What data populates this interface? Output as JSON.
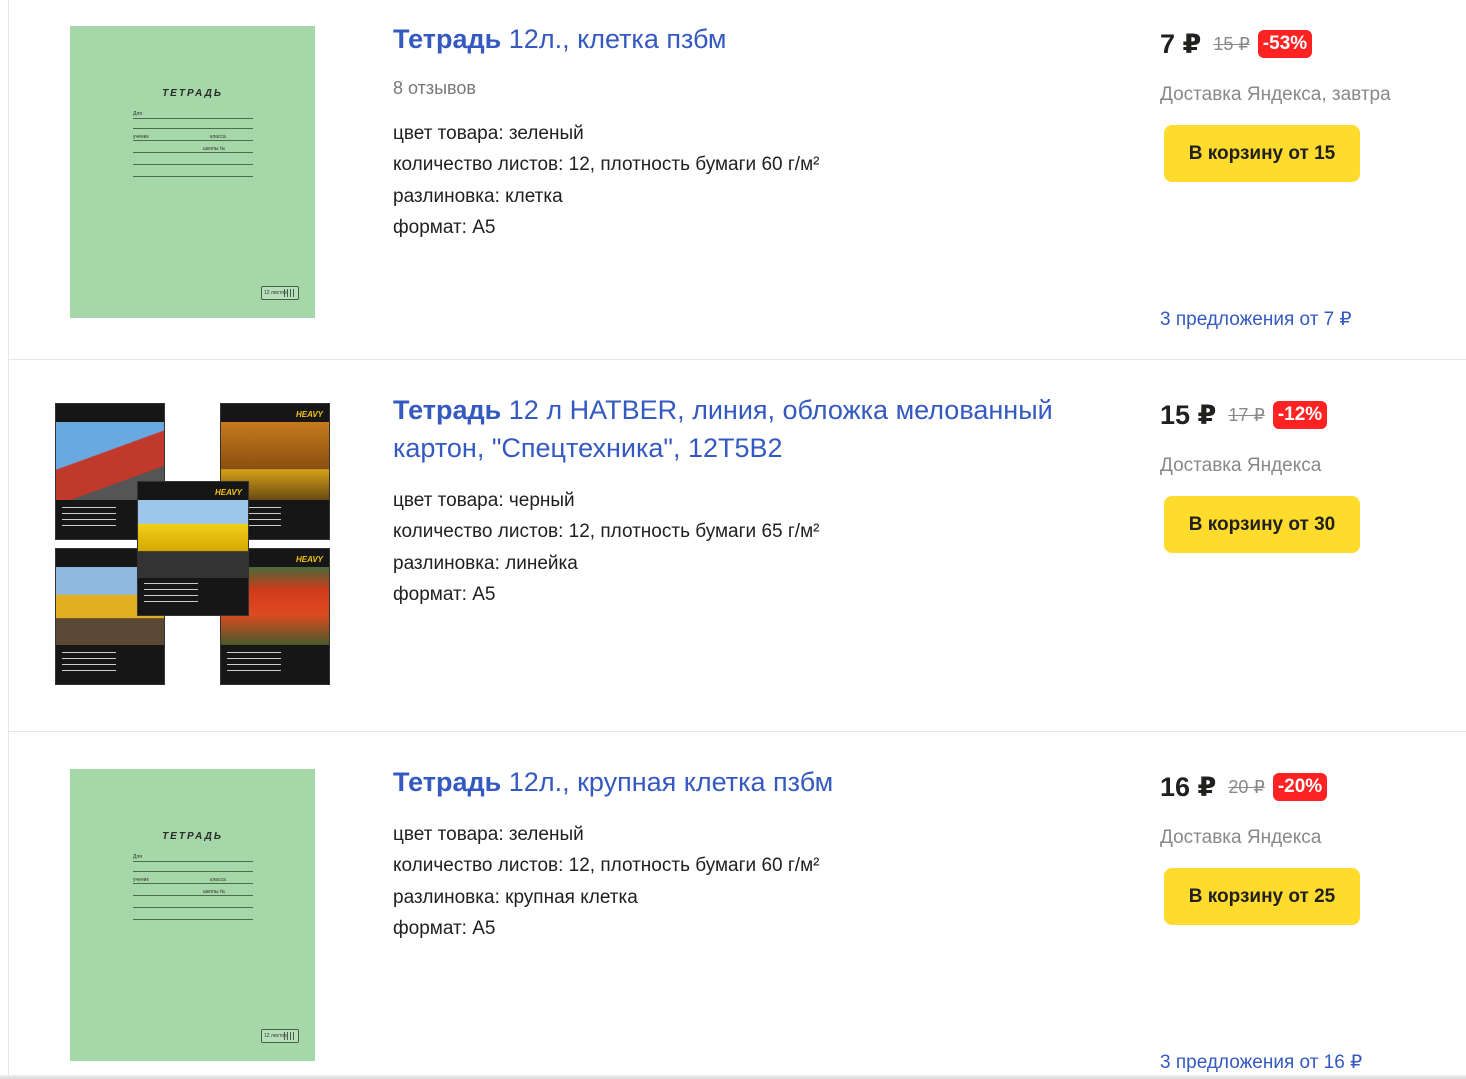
{
  "products": [
    {
      "title_bold": "Тетрадь",
      "title_rest": " 12л., клетка пзбм",
      "reviews": "8 отзывов",
      "specs": [
        "цвет товара: зеленый",
        "количество листов: 12, плотность бумаги 60 г/м²",
        "разлиновка: клетка",
        "формат: А5"
      ],
      "price": "7 ₽",
      "old_price": "15 ₽",
      "discount": "-53%",
      "delivery": "Доставка Яндекса, завтра",
      "cart_button": "В корзину от 15",
      "offers": "3 предложения от 7 ₽",
      "cover": {
        "title": "ТЕТРАДЬ",
        "for": "Для",
        "student": "ученик",
        "class": "класса",
        "school": "школы №",
        "badge": "12 листов"
      }
    },
    {
      "title_bold": "Тетрадь",
      "title_rest": " 12 л HATBER, линия, обложка мелованный картон, \"Спецтехника\", 12Т5В2",
      "reviews": "",
      "specs": [
        "цвет товара: черный",
        "количество листов: 12, плотность бумаги 65 г/м²",
        "разлиновка: линейка",
        "формат: А5"
      ],
      "price": "15 ₽",
      "old_price": "17 ₽",
      "discount": "-12%",
      "delivery": "Доставка Яндекса",
      "cart_button": "В корзину от 30",
      "offers": "",
      "cover": {
        "brand": "HEAVY"
      }
    },
    {
      "title_bold": "Тетрадь",
      "title_rest": " 12л., крупная клетка пзбм",
      "reviews": "",
      "specs": [
        "цвет товара: зеленый",
        "количество листов: 12, плотность бумаги 60 г/м²",
        "разлиновка: крупная клетка",
        "формат: А5"
      ],
      "price": "16 ₽",
      "old_price": "20 ₽",
      "discount": "-20%",
      "delivery": "Доставка Яндекса",
      "cart_button": "В корзину от 25",
      "offers": "3 предложения от 16 ₽",
      "cover": {
        "title": "ТЕТРАДЬ",
        "for": "Для",
        "student": "ученик",
        "class": "класса",
        "school": "школы №",
        "badge": "12 листов"
      }
    }
  ],
  "colors": {
    "link": "#3459c0",
    "cart_button": "#ffdb2d",
    "discount": "#ff2222",
    "cover_green": "#a5d7a8"
  }
}
